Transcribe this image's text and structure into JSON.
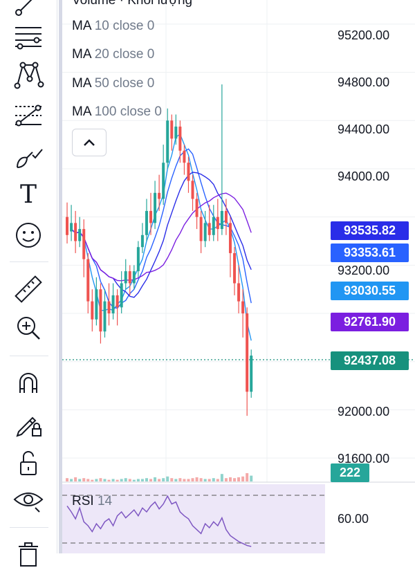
{
  "legend": {
    "top_partial": "Volume · Khối lượng",
    "ma_lines": [
      {
        "name": "MA",
        "args": "10 close 0"
      },
      {
        "name": "MA",
        "args": "20 close 0"
      },
      {
        "name": "MA",
        "args": "50 close 0"
      },
      {
        "name": "MA",
        "args": "100 close 0"
      }
    ]
  },
  "toolbar": {
    "icons": [
      "trend-line-icon",
      "horizontal-lines-icon",
      "pattern-icon",
      "forecast-icon",
      "brush-icon",
      "text-tool-icon",
      "emoji-icon",
      "ruler-icon",
      "zoom-in-icon",
      "magnet-icon",
      "lock-drawing-icon",
      "unlock-icon",
      "eye-icon",
      "trash-icon"
    ],
    "text_tool_glyph": "T"
  },
  "price_axis": {
    "labels": [
      "95200.00",
      "94800.00",
      "94400.00",
      "94000.00",
      "93200.00",
      "92000.00",
      "91600.00"
    ]
  },
  "badges": [
    {
      "value": "93535.82",
      "color": "#2a2de8"
    },
    {
      "value": "93353.61",
      "color": "#2962ff"
    },
    {
      "value": "93030.55",
      "color": "#2196f3"
    },
    {
      "value": "92761.90",
      "color": "#7b1fe0"
    },
    {
      "value": "92437.08",
      "color": "#17917d"
    },
    {
      "value": "222",
      "color": "#26a69a"
    }
  ],
  "rsi": {
    "name": "RSI",
    "args": "14",
    "level_label": "60.00"
  },
  "chart_data": {
    "type": "candlestick",
    "ylim": [
      91400,
      95400
    ],
    "last_price": 92437.08,
    "candles": [
      [
        93600,
        93450,
        93720,
        93380
      ],
      [
        93480,
        93550,
        93700,
        93400
      ],
      [
        93550,
        93400,
        93650,
        93300
      ],
      [
        93400,
        93500,
        93600,
        93350
      ],
      [
        93500,
        93250,
        93580,
        93100
      ],
      [
        93250,
        92900,
        93300,
        92800
      ],
      [
        92900,
        92750,
        93000,
        92650
      ],
      [
        92750,
        93000,
        93100,
        92700
      ],
      [
        93000,
        92650,
        93050,
        92550
      ],
      [
        92650,
        92900,
        93000,
        92600
      ],
      [
        92900,
        92800,
        93050,
        92700
      ],
      [
        92800,
        92950,
        93050,
        92750
      ],
      [
        92950,
        92850,
        93000,
        92700
      ],
      [
        92850,
        93050,
        93150,
        92800
      ],
      [
        93050,
        93150,
        93250,
        93000
      ],
      [
        93150,
        93050,
        93200,
        92950
      ],
      [
        93050,
        93150,
        93200,
        93000
      ],
      [
        93150,
        93350,
        93400,
        93100
      ],
      [
        93350,
        93450,
        93550,
        93300
      ],
      [
        93450,
        93650,
        93750,
        93400
      ],
      [
        93650,
        93550,
        93800,
        93450
      ],
      [
        93550,
        93800,
        93900,
        93500
      ],
      [
        93800,
        93750,
        93950,
        93650
      ],
      [
        93750,
        94050,
        94200,
        93700
      ],
      [
        94050,
        94400,
        94500,
        94000
      ],
      [
        94400,
        94250,
        94450,
        94150
      ],
      [
        94250,
        94350,
        94450,
        94200
      ],
      [
        94350,
        94150,
        94400,
        94050
      ],
      [
        94150,
        94050,
        94200,
        93950
      ],
      [
        94050,
        93900,
        94100,
        93800
      ],
      [
        93900,
        93750,
        93950,
        93650
      ],
      [
        93750,
        93600,
        93800,
        93500
      ],
      [
        93600,
        93400,
        93650,
        93300
      ],
      [
        93400,
        93550,
        93650,
        93350
      ],
      [
        93550,
        93450,
        93700,
        93400
      ],
      [
        93450,
        93600,
        93700,
        93400
      ],
      [
        93600,
        93500,
        93750,
        93400
      ],
      [
        93500,
        93650,
        94700,
        93450
      ],
      [
        93650,
        93550,
        93750,
        93450
      ],
      [
        93550,
        93300,
        93600,
        93100
      ],
      [
        93300,
        93050,
        93350,
        92950
      ],
      [
        93050,
        92900,
        93200,
        92800
      ],
      [
        92900,
        92800,
        93000,
        92600
      ],
      [
        92800,
        92150,
        92850,
        91950
      ],
      [
        92150,
        92450,
        92500,
        92100
      ]
    ],
    "volume": [
      4,
      3,
      5,
      3,
      4,
      3,
      2,
      3,
      4,
      3,
      2,
      3,
      2,
      3,
      4,
      3,
      2,
      3,
      3,
      4,
      3,
      5,
      3,
      4,
      6,
      4,
      3,
      4,
      3,
      3,
      4,
      5,
      4,
      3,
      3,
      4,
      3,
      9,
      4,
      5,
      4,
      5,
      6,
      10,
      7
    ],
    "rsi": [
      68,
      62,
      55,
      66,
      52,
      48,
      42,
      50,
      45,
      52,
      55,
      48,
      58,
      62,
      56,
      60,
      64,
      58,
      66,
      62,
      68,
      72,
      65,
      70,
      78,
      70,
      72,
      62,
      58,
      55,
      48,
      44,
      40,
      50,
      46,
      52,
      48,
      56,
      44,
      38,
      35,
      32,
      30,
      28,
      27
    ]
  }
}
